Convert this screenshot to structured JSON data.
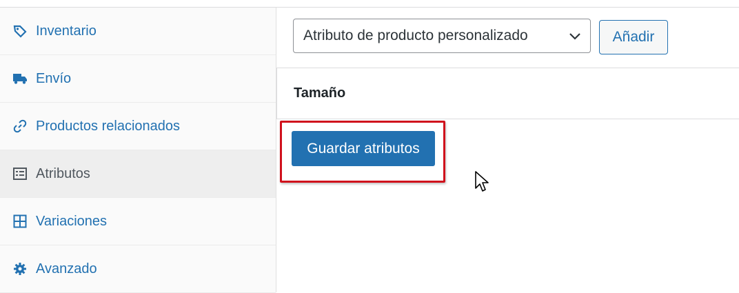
{
  "sidebar": {
    "items": [
      {
        "label": "Inventario",
        "icon": "tag-icon",
        "active": false
      },
      {
        "label": "Envío",
        "icon": "truck-icon",
        "active": false
      },
      {
        "label": "Productos relacionados",
        "icon": "link-icon",
        "active": false
      },
      {
        "label": "Atributos",
        "icon": "list-icon",
        "active": true
      },
      {
        "label": "Variaciones",
        "icon": "grid-icon",
        "active": false
      },
      {
        "label": "Avanzado",
        "icon": "gear-icon",
        "active": false
      }
    ]
  },
  "main": {
    "attribute_select": {
      "value": "Atributo de producto personalizado"
    },
    "add_button": "Añadir",
    "attribute_row": {
      "label": "Tamaño"
    },
    "save_button": "Guardar atributos"
  },
  "colors": {
    "accent": "#2271b1",
    "highlight": "#d0101c"
  }
}
